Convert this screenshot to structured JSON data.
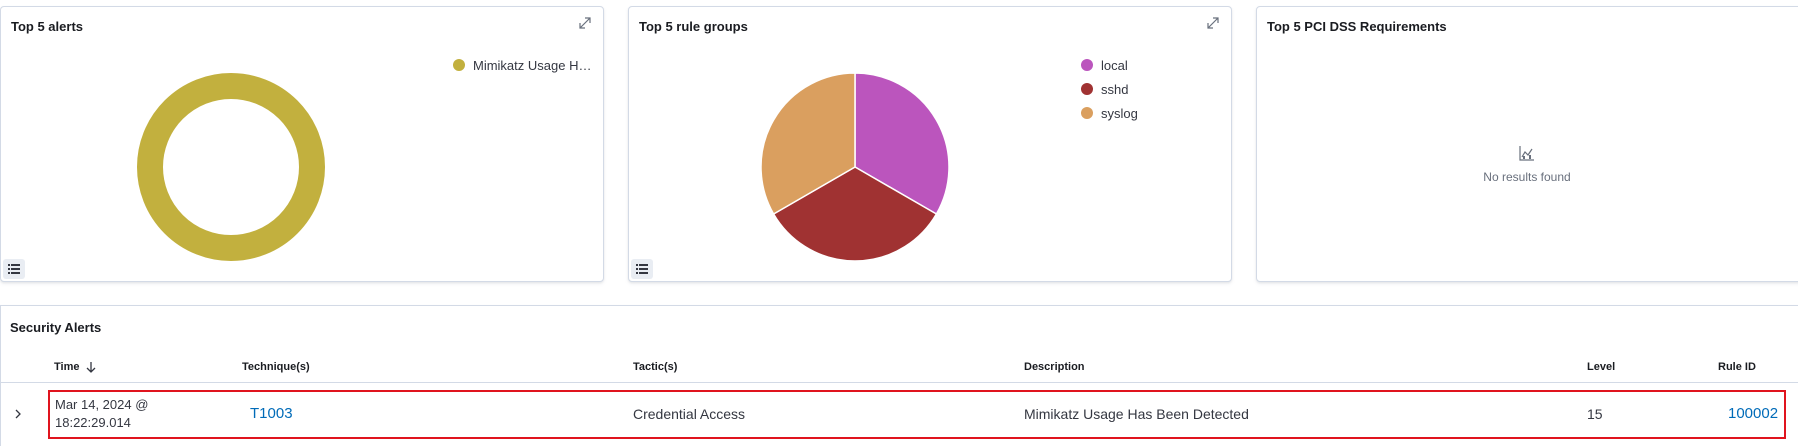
{
  "panels": {
    "top_alerts": {
      "title": "Top 5 alerts",
      "legend": [
        {
          "label": "Mimikatz Usage Ha…",
          "color": "#c2b03e"
        }
      ]
    },
    "top_rule_groups": {
      "title": "Top 5 rule groups",
      "legend": [
        {
          "label": "local",
          "color": "#bb55bd"
        },
        {
          "label": "sshd",
          "color": "#a03232"
        },
        {
          "label": "syslog",
          "color": "#da9f5f"
        }
      ]
    },
    "top_pci": {
      "title": "Top 5 PCI DSS Requirements",
      "empty_text": "No results found"
    }
  },
  "chart_data": [
    {
      "type": "pie",
      "donut": true,
      "title": "Top 5 alerts",
      "categories": [
        "Mimikatz Usage Ha…"
      ],
      "values": [
        1
      ],
      "colors": [
        "#c2b03e"
      ]
    },
    {
      "type": "pie",
      "title": "Top 5 rule groups",
      "categories": [
        "local",
        "sshd",
        "syslog"
      ],
      "values": [
        1,
        1,
        1
      ],
      "colors": [
        "#bb55bd",
        "#a03232",
        "#da9f5f"
      ]
    }
  ],
  "security_alerts": {
    "title": "Security Alerts",
    "columns": {
      "time": "Time",
      "technique": "Technique(s)",
      "tactic": "Tactic(s)",
      "description": "Description",
      "level": "Level",
      "rule_id": "Rule ID"
    },
    "rows": [
      {
        "time_line1": "Mar 14, 2024 @",
        "time_line2": "18:22:29.014",
        "technique": "T1003",
        "tactic": "Credential Access",
        "description": "Mimikatz Usage Has Been Detected",
        "level": "15",
        "rule_id": "100002"
      }
    ]
  },
  "icons": {
    "expand": "expand-arrows-icon",
    "legend_toggle": "list-icon",
    "sort": "arrow-down-icon",
    "row_expand": "chevron-right-icon",
    "empty": "chart-icon"
  }
}
